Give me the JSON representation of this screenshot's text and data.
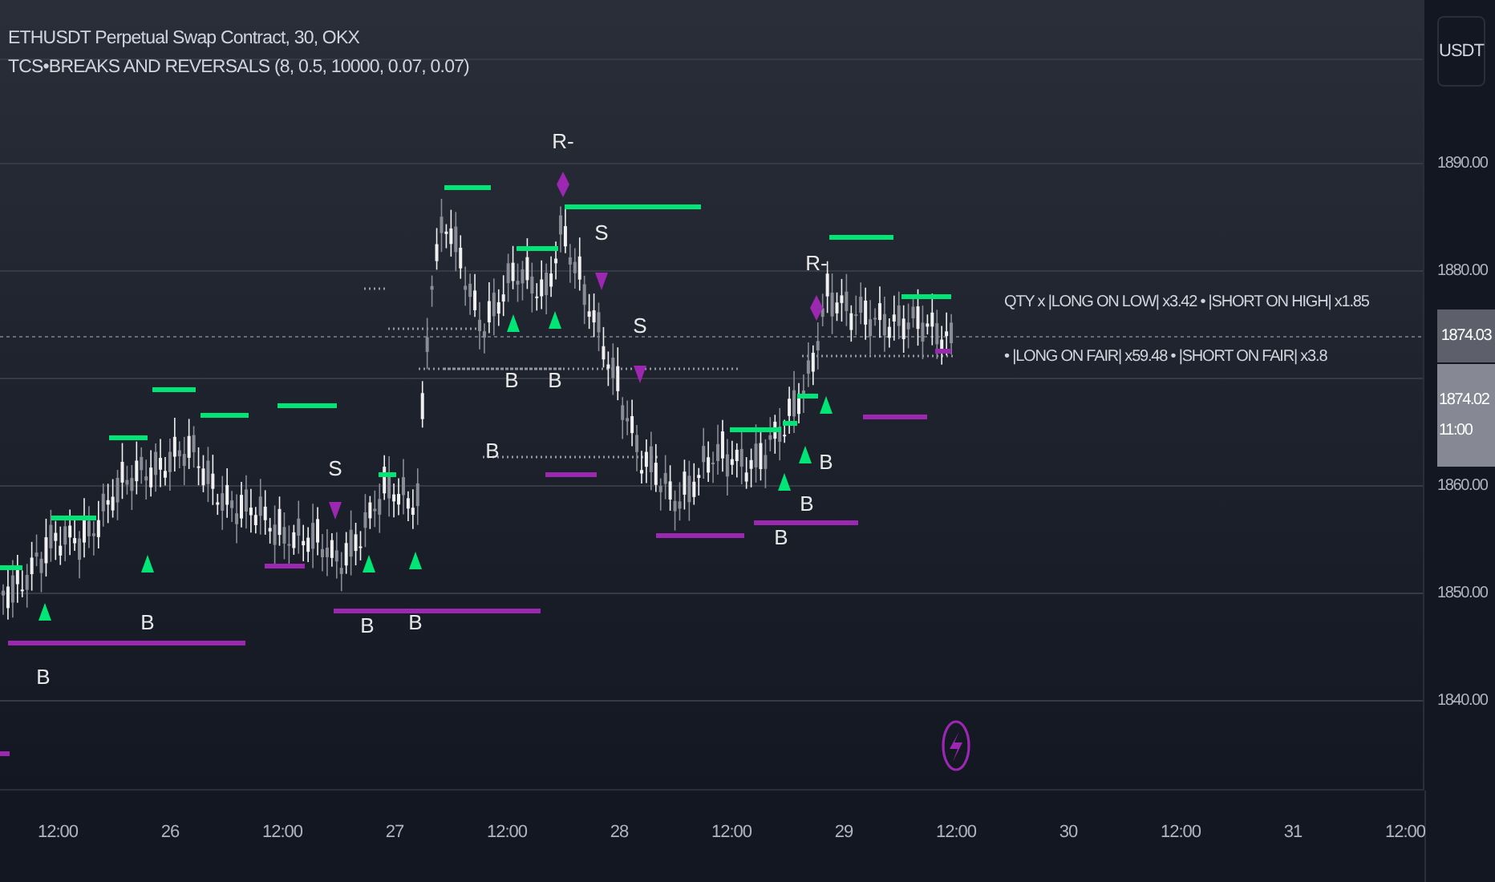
{
  "header": {
    "symbol": "ETHUSDT Perpetual Swap Contract, 30, OKX",
    "indicator": "TCS•BREAKS AND REVERSALS (8, 0.5, 10000, 0.07, 0.07)"
  },
  "currency_button": "USDT",
  "price_axis": [
    "1890.00",
    "1880.00",
    "1860.00",
    "1850.00",
    "1840.00"
  ],
  "last_price": "1874.03",
  "crosshair_price": {
    "price": "1874.02",
    "countdown": "11:00"
  },
  "time_axis": [
    "12:00",
    "26",
    "12:00",
    "27",
    "12:00",
    "28",
    "12:00",
    "29",
    "12:00",
    "30",
    "12:00",
    "31",
    "12:00"
  ],
  "signal_labels": [
    "R-",
    "S",
    "S",
    "S",
    "R-",
    "B",
    "B",
    "B",
    "B",
    "B",
    "B",
    "B",
    "B",
    "B",
    "B"
  ],
  "info_lines": [
    "QTY x |LONG ON LOW| x3.42 • |SHORT ON HIGH| x1.85",
    "• |LONG ON FAIR| x59.48 • |SHORT ON FAIR| x3.8"
  ]
}
